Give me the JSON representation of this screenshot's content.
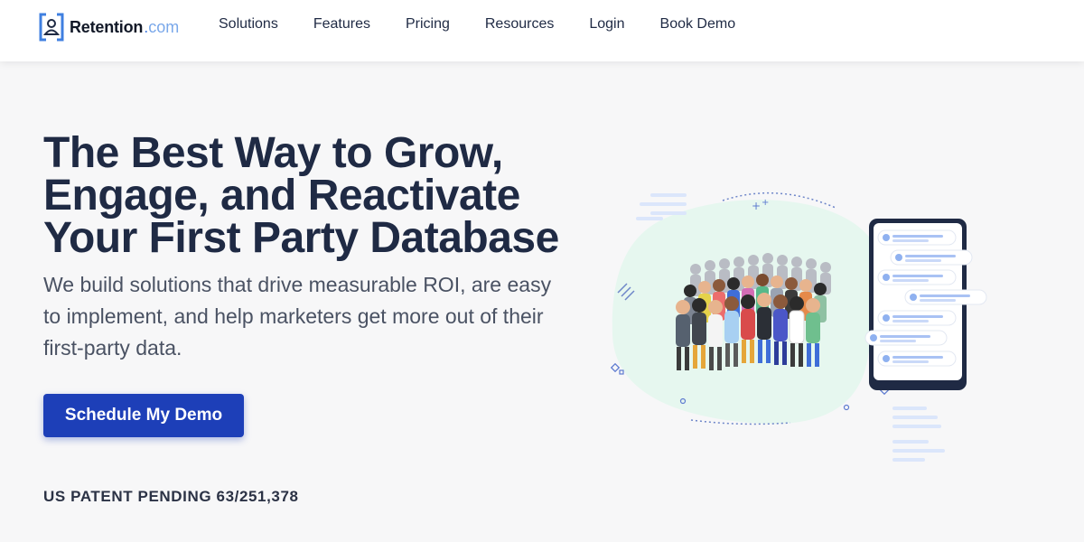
{
  "header": {
    "logo": {
      "name": "Retention",
      "dot": ".",
      "suffix": "com"
    },
    "nav": [
      {
        "label": "Solutions"
      },
      {
        "label": "Features"
      },
      {
        "label": "Pricing"
      },
      {
        "label": "Resources"
      },
      {
        "label": "Login"
      },
      {
        "label": "Book Demo"
      }
    ]
  },
  "hero": {
    "title_lines": [
      "The Best Way to Grow,",
      "Engage, and Reactivate",
      "Your First Party Database"
    ],
    "subtitle": "We build solutions that drive measurable ROI, are easy to implement, and help marketers get more out of their first-party data.",
    "cta_label": "Schedule My Demo",
    "patent_text": "US PATENT PENDING 63/251,378"
  },
  "colors": {
    "brand": "#1d3fb8",
    "logo_accent": "#4a7fe0",
    "blob": "#e6f7ef",
    "heading": "#1f2a44"
  },
  "icons": {
    "logo": "user-card-icon",
    "illustration": "crowd-and-phone-illustration"
  }
}
